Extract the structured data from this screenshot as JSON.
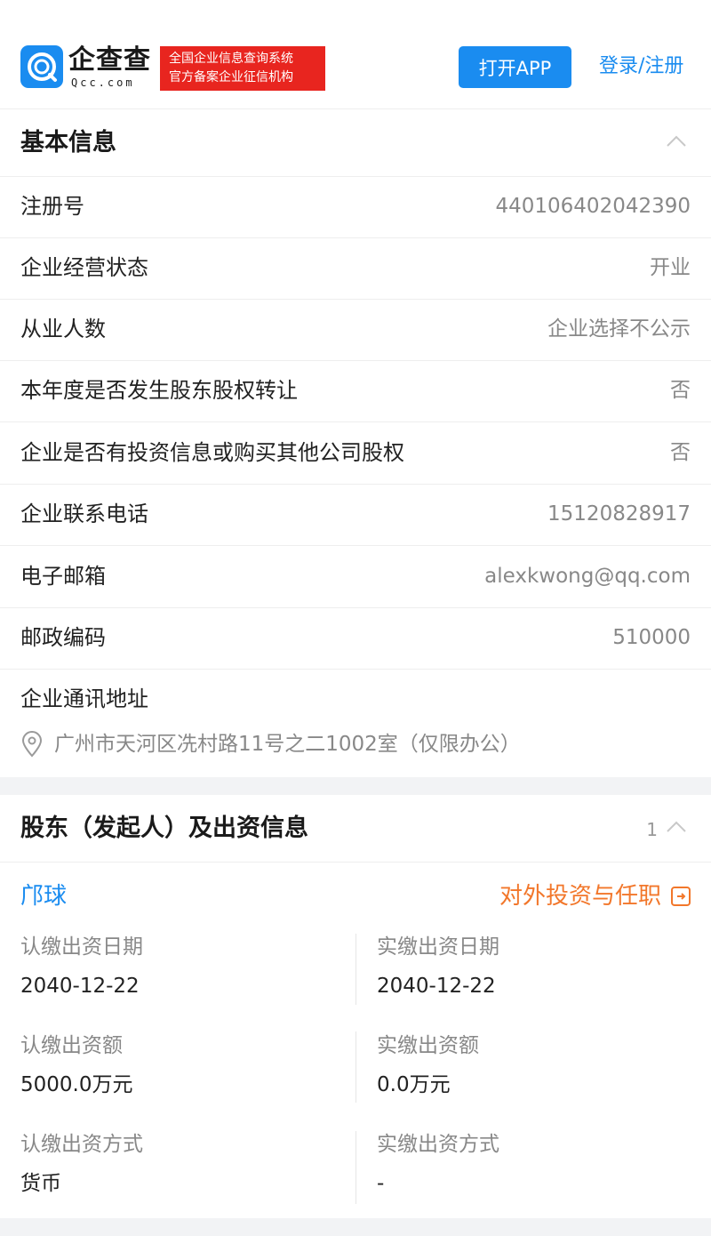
{
  "header": {
    "logo_cn": "企查查",
    "logo_en": "Qcc.com",
    "badge_line1": "全国企业信息查询系统",
    "badge_line2": "官方备案企业征信机构",
    "open_app_label": "打开APP",
    "login_label": "登录/注册",
    "brand_color": "#1a8cf0",
    "badge_color": "#e8251f"
  },
  "basic_info": {
    "title": "基本信息",
    "rows": [
      {
        "label": "注册号",
        "value": "440106402042390"
      },
      {
        "label": "企业经营状态",
        "value": "开业"
      },
      {
        "label": "从业人数",
        "value": "企业选择不公示"
      },
      {
        "label": "本年度是否发生股东股权转让",
        "value": "否"
      },
      {
        "label": "企业是否有投资信息或购买其他公司股权",
        "value": "否"
      },
      {
        "label": "企业联系电话",
        "value": "15120828917"
      },
      {
        "label": "电子邮箱",
        "value": "alexkwong@qq.com"
      },
      {
        "label": "邮政编码",
        "value": "510000"
      }
    ],
    "address_label": "企业通讯地址",
    "address_value": "广州市天河区冼村路11号之二1002室（仅限办公）"
  },
  "shareholders": {
    "title": "股东（发起人）及出资信息",
    "count": "1",
    "name": "邝球",
    "invest_link_label": "对外投资与任职",
    "invest_link_color": "#f2772b",
    "fields": {
      "subscribed_date_label": "认缴出资日期",
      "subscribed_date_value": "2040-12-22",
      "paid_date_label": "实缴出资日期",
      "paid_date_value": "2040-12-22",
      "subscribed_amount_label": "认缴出资额",
      "subscribed_amount_value": "5000.0万元",
      "paid_amount_label": "实缴出资额",
      "paid_amount_value": "0.0万元",
      "subscribed_method_label": "认缴出资方式",
      "subscribed_method_value": "货币",
      "paid_method_label": "实缴出资方式",
      "paid_method_value": "-"
    }
  }
}
